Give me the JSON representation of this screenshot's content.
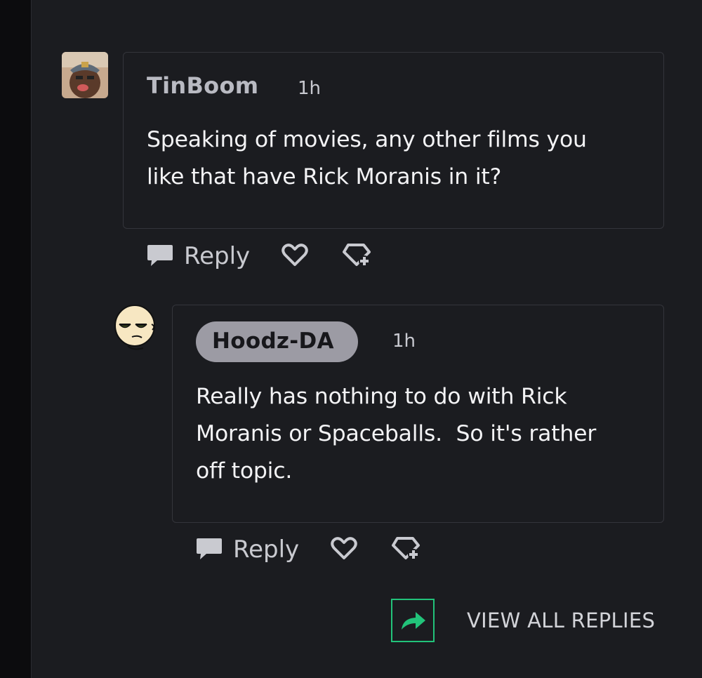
{
  "thread": {
    "comments": [
      {
        "username": "TinBoom",
        "time": "1h",
        "body": "Speaking of movies, any other films you\nlike that have Rick Moranis in it?",
        "actions": {
          "reply_label": "Reply",
          "like_icon": "heart-icon",
          "award_icon": "award-icon"
        }
      },
      {
        "username": "Hoodz-DA",
        "time": "1h",
        "body": "Really has nothing to do with Rick\nMoranis or Spaceballs.  So it's rather\noff topic.",
        "actions": {
          "reply_label": "Reply",
          "like_icon": "heart-icon",
          "award_icon": "award-icon"
        }
      }
    ],
    "view_all_replies": "VIEW ALL REPLIES"
  },
  "colors": {
    "background": "#1b1c20",
    "card_border": "#34353b",
    "accent_green": "#22c37a",
    "username_pill": "#9c9ba4"
  }
}
